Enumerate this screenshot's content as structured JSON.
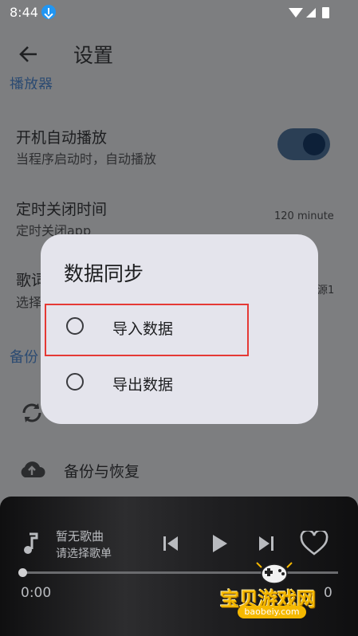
{
  "status_bar": {
    "time": "8:44"
  },
  "header": {
    "title": "设置"
  },
  "settings": {
    "section_player_clip": "播放器",
    "autoplay": {
      "title": "开机自动播放",
      "subtitle": "当程序启动时，自动播放"
    },
    "timer": {
      "title": "定时关闭时间",
      "subtitle": "定时关闭app",
      "value": "120 minute"
    },
    "lyrics": {
      "title_partial": "歌词",
      "subtitle_partial": "选择",
      "value_partial": "源1"
    },
    "section_backup": "备份",
    "backup_restore": {
      "label": "备份与恢复"
    }
  },
  "dialog": {
    "title": "数据同步",
    "options": [
      {
        "label": "导入数据"
      },
      {
        "label": "导出数据"
      }
    ]
  },
  "player": {
    "song_title": "暂无歌曲",
    "song_subtitle": "请选择歌单",
    "time_current": "0:00",
    "time_end_partial": "0",
    "progress": 0
  },
  "watermark": {
    "text": "宝贝游戏网",
    "url": "baobeiy.com"
  },
  "colors": {
    "accent": "#2c4b72",
    "dialog_bg": "#e4e4ec",
    "highlight": "#e53935"
  }
}
